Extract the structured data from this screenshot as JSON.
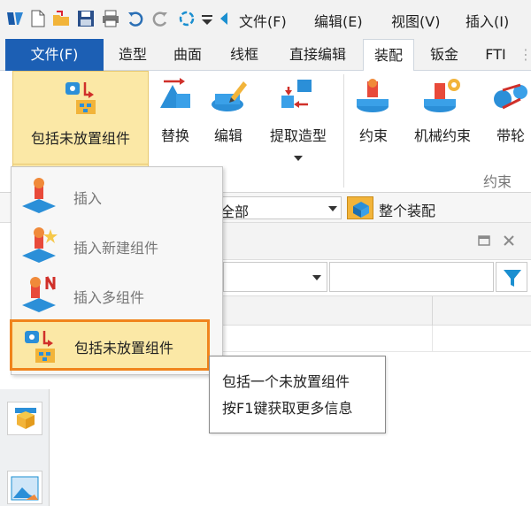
{
  "menubar": {
    "items": [
      "文件(F)",
      "编辑(E)",
      "视图(V)",
      "插入(I)"
    ]
  },
  "tabs": [
    "文件(F)",
    "造型",
    "曲面",
    "线框",
    "直接编辑",
    "装配",
    "钣金",
    "FTI"
  ],
  "ribbon": {
    "buttons": {
      "include_unplaced": "包括未放置组件",
      "replace": "替换",
      "edit": "编辑",
      "extract_shape": "提取造型",
      "constraint": "约束",
      "mechanical_constraint": "机械约束",
      "belt": "带轮"
    },
    "group_label": "约束"
  },
  "filter": {
    "scope": "全部",
    "assembly": "整个装配"
  },
  "dropdown": {
    "items": [
      "插入",
      "插入新建组件",
      "插入多组件",
      "包括未放置组件"
    ]
  },
  "tooltip": {
    "line1": "包括一个未放置组件",
    "line2": "按F1键获取更多信息"
  },
  "colors": {
    "file_tab": "#1c5fb4",
    "highlight_fill": "#fbe8a6",
    "highlight_border": "#f0841c",
    "filter_icon": "#1b8fd0"
  }
}
